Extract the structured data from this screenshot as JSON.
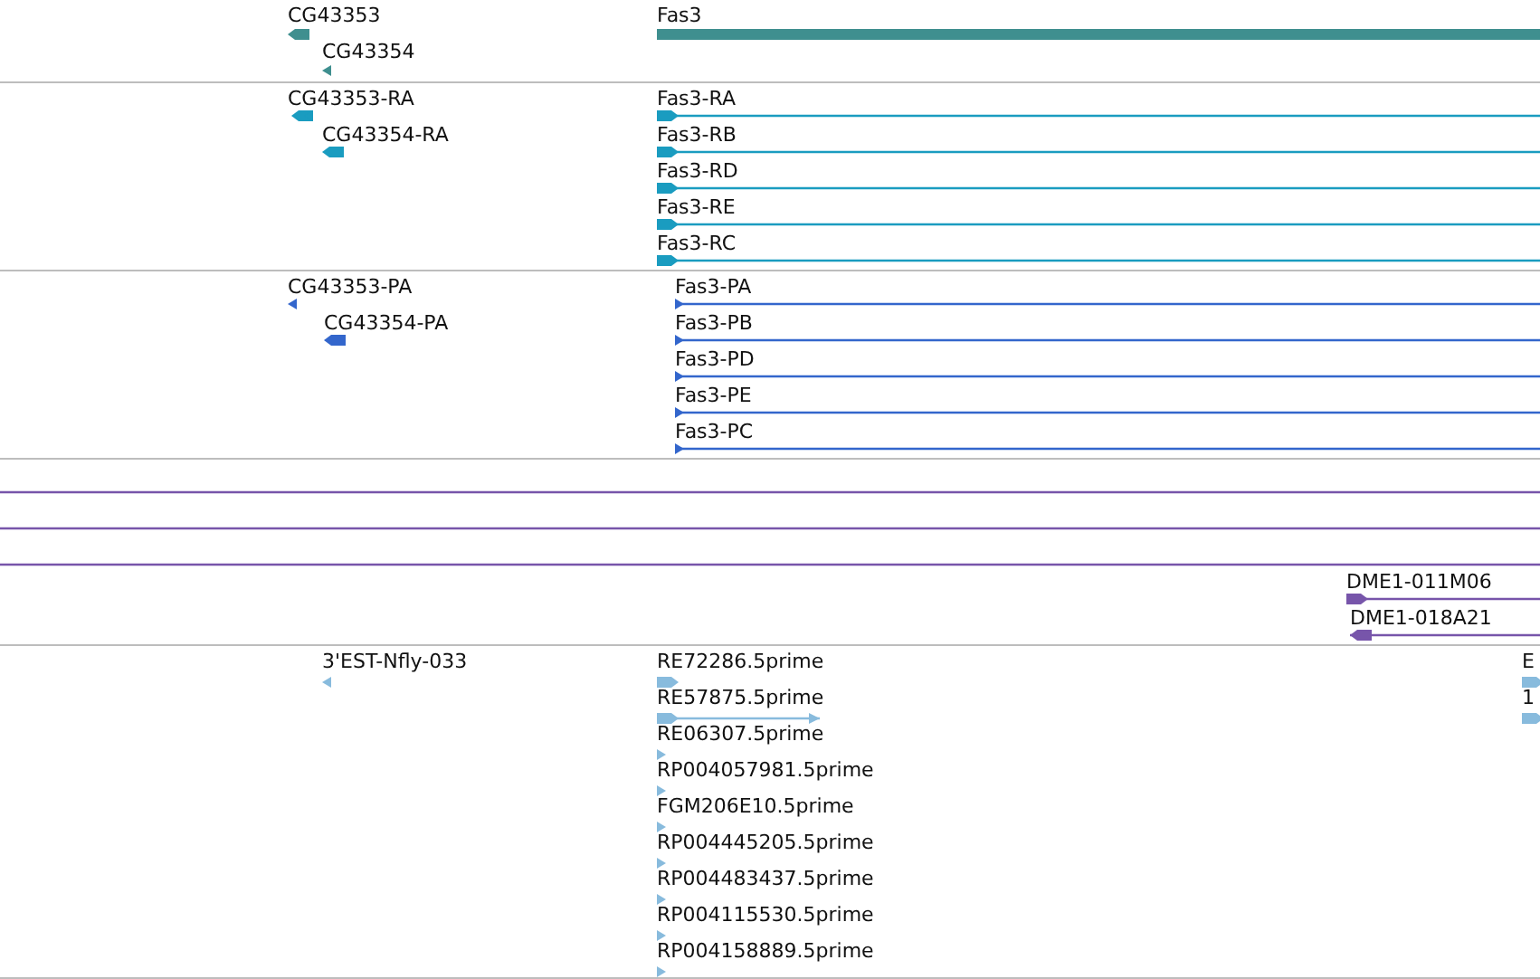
{
  "tracks": [
    {
      "kind": "gene",
      "features": [
        {
          "label": "CG43353",
          "reverse": true
        },
        {
          "label": "CG43354",
          "reverse": true
        },
        {
          "label": "Fas3"
        }
      ]
    },
    {
      "kind": "transcript",
      "features": [
        {
          "label": "CG43353-RA",
          "reverse": true
        },
        {
          "label": "CG43354-RA",
          "reverse": true
        },
        {
          "label": "Fas3-RA",
          "reverse": false
        },
        {
          "label": "Fas3-RB",
          "reverse": false
        },
        {
          "label": "Fas3-RD",
          "reverse": false
        },
        {
          "label": "Fas3-RE",
          "reverse": false
        },
        {
          "label": "Fas3-RC",
          "reverse": false
        }
      ]
    },
    {
      "kind": "polypeptide",
      "features": [
        {
          "label": "CG43353-PA",
          "reverse": true
        },
        {
          "label": "CG43354-PA",
          "reverse": true
        },
        {
          "label": "Fas3-PA",
          "reverse": false
        },
        {
          "label": "Fas3-PB",
          "reverse": false
        },
        {
          "label": "Fas3-PD",
          "reverse": false
        },
        {
          "label": "Fas3-PE",
          "reverse": false
        },
        {
          "label": "Fas3-PC",
          "reverse": false
        }
      ]
    },
    {
      "kind": "clone",
      "features": [
        {
          "kind": "span"
        },
        {
          "kind": "span"
        },
        {
          "kind": "span"
        },
        {
          "kind": "feature",
          "label": "DME1-011M06",
          "reverse": false
        },
        {
          "kind": "feature",
          "label": "DME1-018A21",
          "reverse": true
        }
      ]
    },
    {
      "kind": "est",
      "features": [
        {
          "label": "3'EST-Nfly-033",
          "reverse": true
        },
        {
          "label": "RE72286.5prime",
          "reverse": false
        },
        {
          "label": "RE57875.5prime",
          "reverse": false
        },
        {
          "label": "RE06307.5prime",
          "reverse": false
        },
        {
          "label": "RP004057981.5prime",
          "reverse": false
        },
        {
          "label": "FGM206E10.5prime",
          "reverse": false
        },
        {
          "label": "RP004445205.5prime",
          "reverse": false
        },
        {
          "label": "RP004483437.5prime",
          "reverse": false
        },
        {
          "label": "RP004115530.5prime",
          "reverse": false
        },
        {
          "label": "RP004158889.5prime",
          "reverse": false
        },
        {
          "label": "E",
          "reverse": false
        },
        {
          "label": "1",
          "reverse": false
        }
      ]
    }
  ]
}
